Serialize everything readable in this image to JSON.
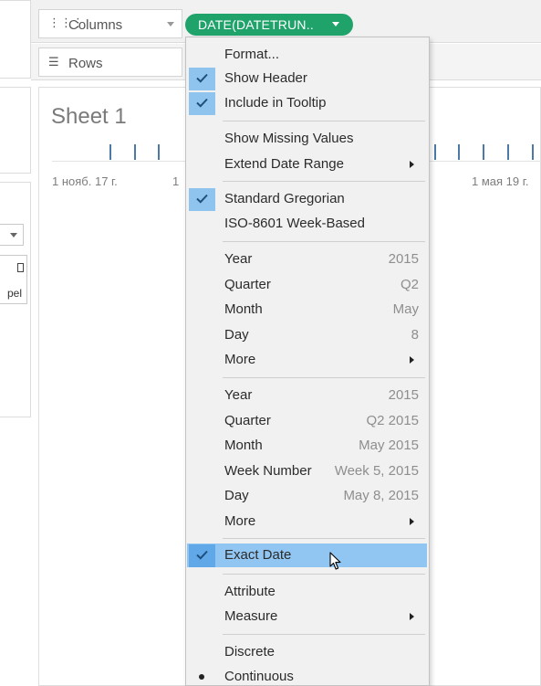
{
  "shelves": {
    "columns_label": "Columns",
    "rows_label": "Rows",
    "pill_label": "DATE(DATETRUN.."
  },
  "left_panel": {
    "card_label_fragment": "pel"
  },
  "sheet": {
    "title": "Sheet 1",
    "axis_labels": [
      "1 нояб. 17 г.",
      "1",
      "1 мая 19 г."
    ]
  },
  "menu": {
    "format": "Format...",
    "show_header": "Show Header",
    "include_tooltip": "Include in Tooltip",
    "show_missing": "Show Missing Values",
    "extend_range": "Extend Date Range",
    "standard_gregorian": "Standard Gregorian",
    "iso_week": "ISO-8601 Week-Based",
    "parts": [
      {
        "label": "Year",
        "value": "2015"
      },
      {
        "label": "Quarter",
        "value": "Q2"
      },
      {
        "label": "Month",
        "value": "May"
      },
      {
        "label": "Day",
        "value": "8"
      },
      {
        "label": "More",
        "value": ""
      }
    ],
    "values": [
      {
        "label": "Year",
        "value": "2015"
      },
      {
        "label": "Quarter",
        "value": "Q2 2015"
      },
      {
        "label": "Month",
        "value": "May 2015"
      },
      {
        "label": "Week Number",
        "value": "Week 5, 2015"
      },
      {
        "label": "Day",
        "value": "May 8, 2015"
      },
      {
        "label": "More",
        "value": ""
      }
    ],
    "exact_date": "Exact Date",
    "attribute": "Attribute",
    "measure": "Measure",
    "discrete": "Discrete",
    "continuous": "Continuous"
  },
  "colors": {
    "pill": "#1fa36b",
    "highlight": "#92c6f2",
    "check_bg": "#8fc4ee",
    "axis_tick": "#4b7aa8"
  }
}
